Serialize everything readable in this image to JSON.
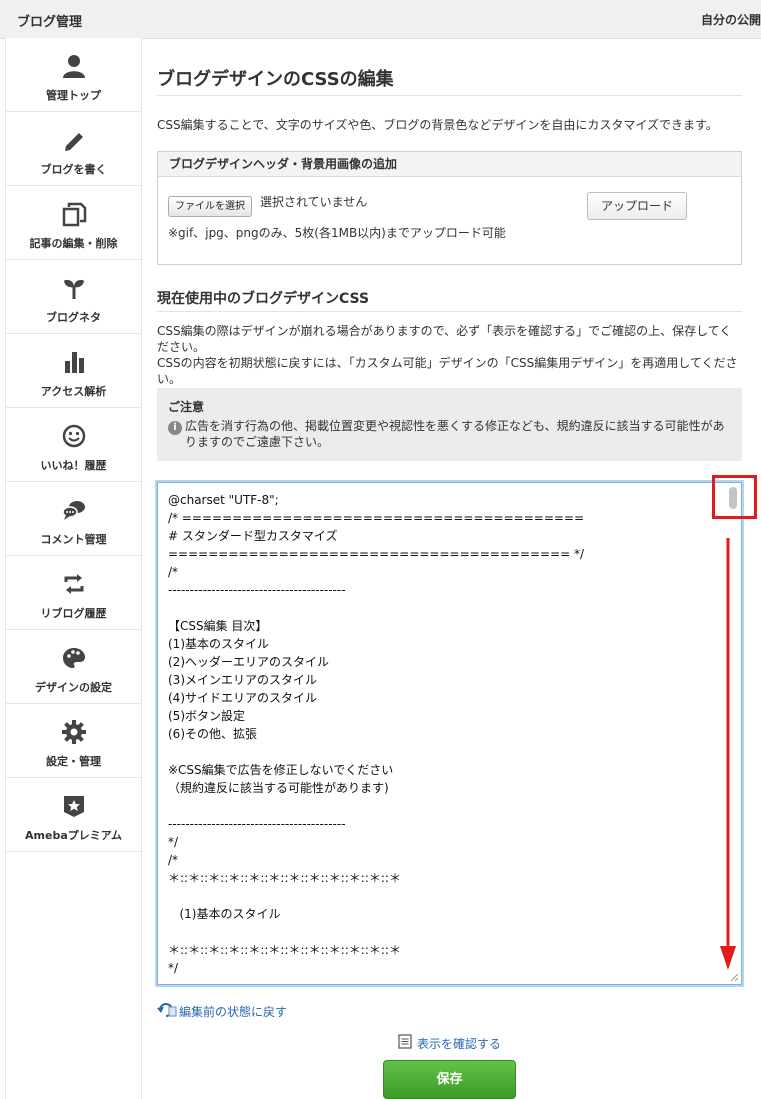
{
  "header": {
    "title": "ブログ管理",
    "right_link": "自分の公開"
  },
  "sidebar": {
    "items": [
      {
        "label": "管理トップ",
        "icon": "person-icon"
      },
      {
        "label": "ブログを書く",
        "icon": "pencil-icon"
      },
      {
        "label": "記事の編集・削除",
        "icon": "documents-icon"
      },
      {
        "label": "ブログネタ",
        "icon": "sprout-icon"
      },
      {
        "label": "アクセス解析",
        "icon": "bar-chart-icon"
      },
      {
        "label": "いいね！履歴",
        "icon": "smiley-icon"
      },
      {
        "label": "コメント管理",
        "icon": "speech-bubbles-icon"
      },
      {
        "label": "リブログ履歴",
        "icon": "reblog-icon"
      },
      {
        "label": "デザインの設定",
        "icon": "palette-icon"
      },
      {
        "label": "設定・管理",
        "icon": "gear-icon"
      },
      {
        "label": "Amebaプレミアム",
        "icon": "star-badge-icon"
      }
    ]
  },
  "main": {
    "title": "ブログデザインのCSSの編集",
    "intro": "CSS編集することで、文字のサイズや色、ブログの背景色などデザインを自由にカスタマイズできます。",
    "upload": {
      "header": "ブログデザインヘッダ・背景用画像の追加",
      "file_button": "ファイルを選択",
      "file_status": "選択されていません",
      "upload_button": "アップロード",
      "note": "※gif、jpg、pngのみ、5枚(各1MB以内)までアップロード可能"
    },
    "current_css": {
      "title": "現在使用中のブログデザインCSS",
      "desc_line1": "CSS編集の際はデザインが崩れる場合がありますので、必ず「表示を確認する」でご確認の上、保存してください。",
      "desc_line2": "CSSの内容を初期状態に戻すには、「カスタム可能」デザインの「CSS編集用デザイン」を再適用してください。"
    },
    "notice": {
      "title": "ご注意",
      "body": "広告を消す行為の他、掲載位置変更や視認性を悪くする修正なども、規約違反に該当する可能性がありますのでご遠慮下さい。"
    },
    "css_code": "@charset \"UTF-8\";\n/* ========================================\n# スタンダード型カスタマイズ\n======================================== */\n/*\n-----------------------------------------\n\n【CSS編集 目次】\n(1)基本のスタイル\n(2)ヘッダーエリアのスタイル\n(3)メインエリアのスタイル\n(4)サイドエリアのスタイル\n(5)ボタン設定\n(6)その他、拡張\n\n※CSS編集で広告を修正しないでください\n（規約違反に該当する可能性があります)\n\n-----------------------------------------\n*/\n/*\n＊::＊::＊::＊::＊::＊::＊::＊::＊::＊::＊::＊\n\n   (1)基本のスタイル\n\n＊::＊::＊::＊::＊::＊::＊::＊::＊::＊::＊::＊\n*/",
    "revert_link": "編集前の状態に戻す",
    "preview_link": "表示を確認する",
    "save_button": "保存"
  },
  "colors": {
    "annotation": "#e01b1b",
    "save": "#4caf2f",
    "link": "#2a67b1",
    "editor_focus": "#7fb0e6"
  }
}
